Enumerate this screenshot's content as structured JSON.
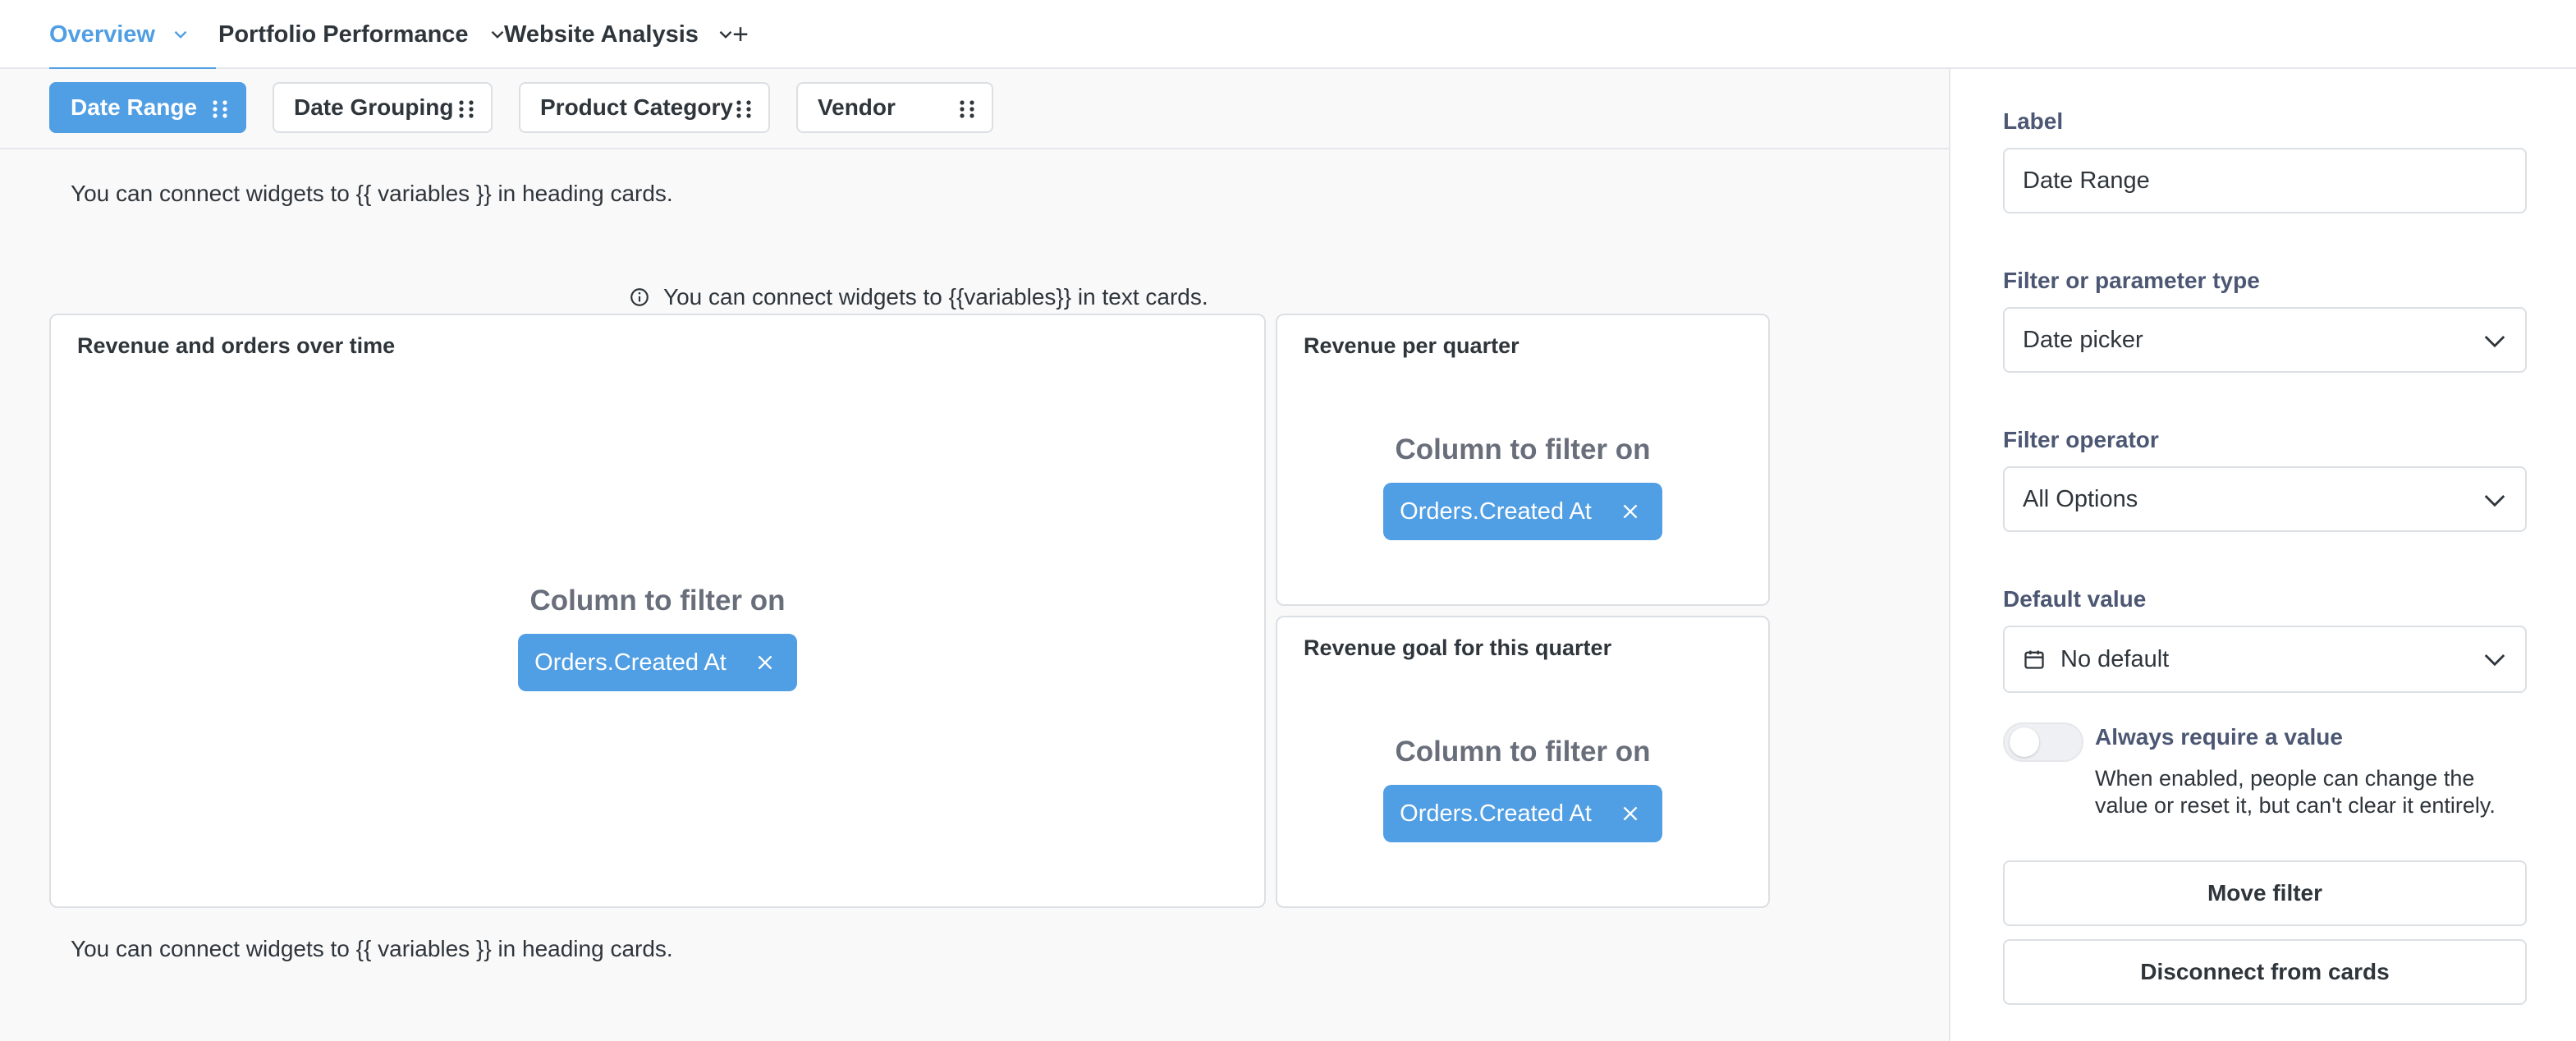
{
  "tabs": [
    {
      "label": "Overview"
    },
    {
      "label": "Portfolio Performance"
    },
    {
      "label": "Website Analysis"
    }
  ],
  "filters": [
    {
      "label": "Date Range"
    },
    {
      "label": "Date Grouping"
    },
    {
      "label": "Product Category"
    },
    {
      "label": "Vendor"
    }
  ],
  "main": {
    "heading_top": "You can connect widgets to {{ variables }} in heading cards.",
    "text_card_info": "You can connect widgets to {{variables}} in text cards.",
    "heading_bottom": "You can connect widgets to {{ variables }} in heading cards.",
    "cards": [
      {
        "title": "Revenue and orders over time",
        "mapping_label": "Column to filter on",
        "column": "Orders.Created At"
      },
      {
        "title": "Revenue per quarter",
        "mapping_label": "Column to filter on",
        "column": "Orders.Created At"
      },
      {
        "title": "Revenue goal for this quarter",
        "mapping_label": "Column to filter on",
        "column": "Orders.Created At"
      }
    ]
  },
  "sidebar": {
    "label_title": "Label",
    "label_value": "Date Range",
    "type_title": "Filter or parameter type",
    "type_value": "Date picker",
    "operator_title": "Filter operator",
    "operator_value": "All Options",
    "default_title": "Default value",
    "default_value": "No default",
    "require_label": "Always require a value",
    "require_desc": "When enabled, people can change the value or reset it, but can't clear it entirely.",
    "move_button": "Move filter",
    "disconnect_button": "Disconnect from cards"
  },
  "colors": {
    "brand": "#509ee3",
    "text_dark": "#2e353b",
    "text_medium": "#4c5773",
    "border": "#dcdfe3"
  }
}
